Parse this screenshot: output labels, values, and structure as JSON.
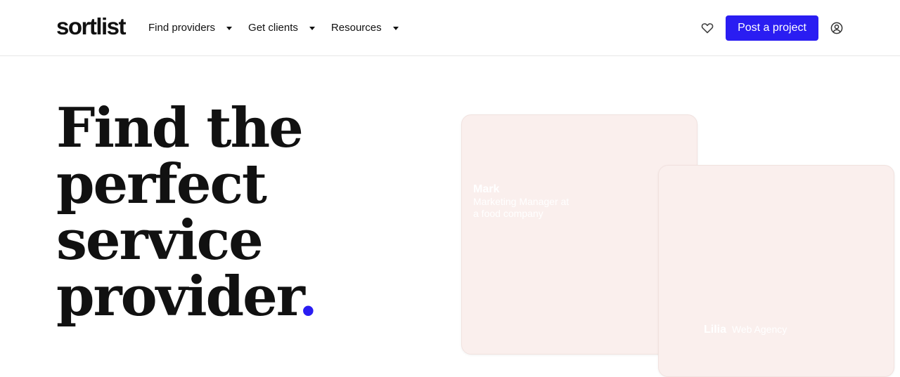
{
  "brand": {
    "logo_text": "sortlist",
    "accent_color": "#2a1df2"
  },
  "nav": {
    "items": [
      {
        "label": "Find providers"
      },
      {
        "label": "Get clients"
      },
      {
        "label": "Resources"
      }
    ]
  },
  "header_actions": {
    "favorites_icon": "heart-icon",
    "post_project_label": "Post a project",
    "account_icon": "user-icon"
  },
  "hero": {
    "headline_lines": [
      "Find the",
      "perfect",
      "service",
      "provider"
    ],
    "headline_punctuation": "."
  },
  "testimonials": [
    {
      "name": "Mark",
      "role": "Marketing Manager at a food company",
      "card_color": "#faefed"
    },
    {
      "name": "Lilia",
      "role": "Web Agency",
      "card_color": "#faefed"
    }
  ]
}
